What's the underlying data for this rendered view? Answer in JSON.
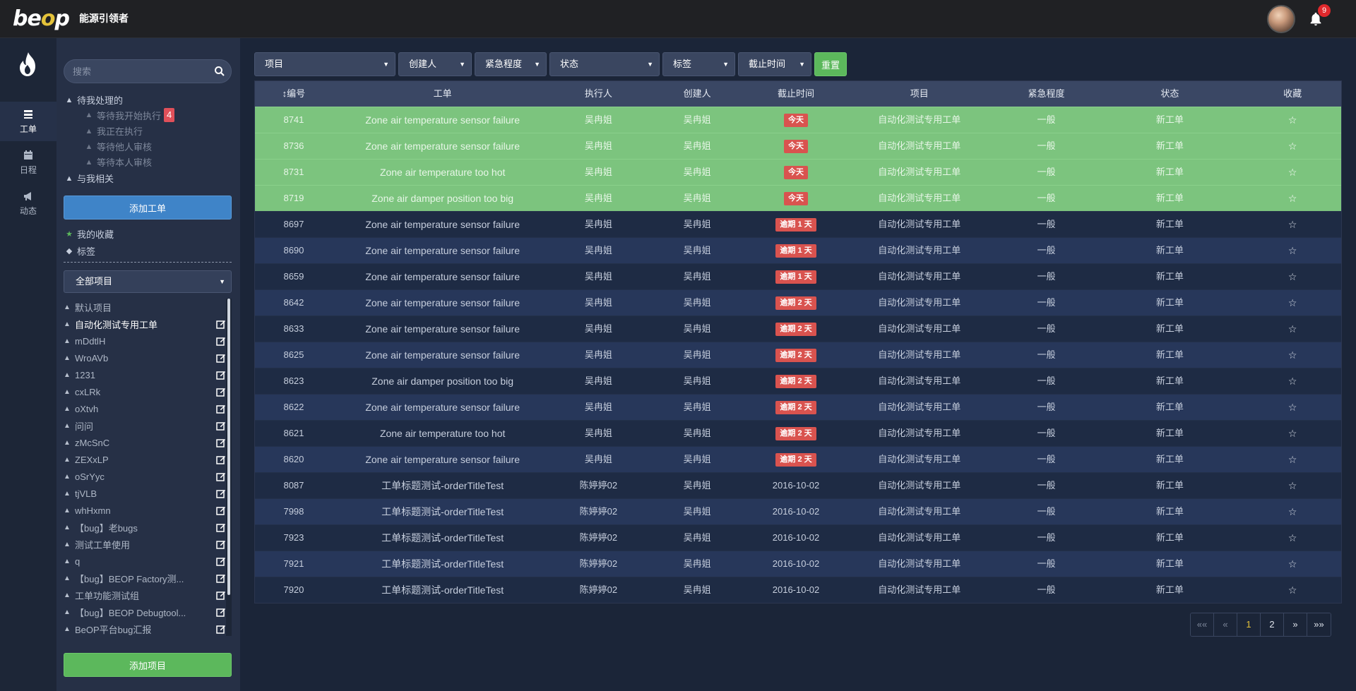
{
  "header": {
    "logo_text": "beop",
    "brand_subtitle": "能源引领者",
    "notification_count": "9",
    "accent": "#e4c23a"
  },
  "iconrail": {
    "items": [
      {
        "label": "工单",
        "icon": "list-icon",
        "active": true
      },
      {
        "label": "日程",
        "icon": "calendar-icon",
        "active": false
      },
      {
        "label": "动态",
        "icon": "megaphone-icon",
        "active": false
      }
    ]
  },
  "sidebar": {
    "search_placeholder": "搜索",
    "pending": {
      "label": "待我处理的",
      "children": [
        {
          "label": "等待我开始执行",
          "badge": "4"
        },
        {
          "label": "我正在执行"
        },
        {
          "label": "等待他人审核"
        },
        {
          "label": "等待本人审核"
        }
      ]
    },
    "related_label": "与我相关",
    "add_workorder_label": "添加工单",
    "favorites_label": "我的收藏",
    "tags_label": "标签",
    "project_select": "全部项目",
    "projects": [
      {
        "name": "默认项目",
        "editable": false
      },
      {
        "name": "自动化测试专用工单",
        "editable": true,
        "active": true
      },
      {
        "name": "mDdtlH",
        "editable": true
      },
      {
        "name": "WroAVb",
        "editable": true
      },
      {
        "name": "1231",
        "editable": true
      },
      {
        "name": "cxLRk",
        "editable": true
      },
      {
        "name": "oXtvh",
        "editable": true
      },
      {
        "name": "问问",
        "editable": true
      },
      {
        "name": "zMcSnC",
        "editable": true
      },
      {
        "name": "ZEXxLP",
        "editable": true
      },
      {
        "name": "oSrYyc",
        "editable": true
      },
      {
        "name": "tjVLB",
        "editable": true
      },
      {
        "name": "whHxmn",
        "editable": true
      },
      {
        "name": "【bug】老bugs",
        "editable": true
      },
      {
        "name": "测试工单使用",
        "editable": true
      },
      {
        "name": "q",
        "editable": true
      },
      {
        "name": "【bug】BEOP Factory测...",
        "editable": true
      },
      {
        "name": "工单功能测试组",
        "editable": true
      },
      {
        "name": "【bug】BEOP Debugtool...",
        "editable": true
      },
      {
        "name": "BeOP平台bug汇报",
        "editable": true
      }
    ],
    "add_project_label": "添加项目"
  },
  "filters": [
    {
      "label": "项目"
    },
    {
      "label": "创建人"
    },
    {
      "label": "紧急程度"
    },
    {
      "label": "状态"
    },
    {
      "label": "标签"
    },
    {
      "label": "截止时间"
    }
  ],
  "reset_label": "重置",
  "table": {
    "columns": [
      "编号",
      "工单",
      "执行人",
      "创建人",
      "截止时间",
      "项目",
      "紧急程度",
      "状态",
      "收藏"
    ],
    "rows": [
      {
        "id": "8741",
        "title": "Zone air temperature sensor failure",
        "executor": "吴冉姐",
        "creator": "吴冉姐",
        "deadline": "今天",
        "deadline_tag": true,
        "project": "自动化测试专用工单",
        "urgency": "一般",
        "status": "新工单",
        "hl": true
      },
      {
        "id": "8736",
        "title": "Zone air temperature sensor failure",
        "executor": "吴冉姐",
        "creator": "吴冉姐",
        "deadline": "今天",
        "deadline_tag": true,
        "project": "自动化测试专用工单",
        "urgency": "一般",
        "status": "新工单",
        "hl": true
      },
      {
        "id": "8731",
        "title": "Zone air temperature too hot",
        "executor": "吴冉姐",
        "creator": "吴冉姐",
        "deadline": "今天",
        "deadline_tag": true,
        "project": "自动化测试专用工单",
        "urgency": "一般",
        "status": "新工单",
        "hl": true
      },
      {
        "id": "8719",
        "title": "Zone air damper position too big",
        "executor": "吴冉姐",
        "creator": "吴冉姐",
        "deadline": "今天",
        "deadline_tag": true,
        "project": "自动化测试专用工单",
        "urgency": "一般",
        "status": "新工单",
        "hl": true
      },
      {
        "id": "8697",
        "title": "Zone air temperature sensor failure",
        "executor": "吴冉姐",
        "creator": "吴冉姐",
        "deadline": "逾期 1 天",
        "deadline_tag": true,
        "project": "自动化测试专用工单",
        "urgency": "一般",
        "status": "新工单"
      },
      {
        "id": "8690",
        "title": "Zone air temperature sensor failure",
        "executor": "吴冉姐",
        "creator": "吴冉姐",
        "deadline": "逾期 1 天",
        "deadline_tag": true,
        "project": "自动化测试专用工单",
        "urgency": "一般",
        "status": "新工单"
      },
      {
        "id": "8659",
        "title": "Zone air temperature sensor failure",
        "executor": "吴冉姐",
        "creator": "吴冉姐",
        "deadline": "逾期 1 天",
        "deadline_tag": true,
        "project": "自动化测试专用工单",
        "urgency": "一般",
        "status": "新工单"
      },
      {
        "id": "8642",
        "title": "Zone air temperature sensor failure",
        "executor": "吴冉姐",
        "creator": "吴冉姐",
        "deadline": "逾期 2 天",
        "deadline_tag": true,
        "project": "自动化测试专用工单",
        "urgency": "一般",
        "status": "新工单"
      },
      {
        "id": "8633",
        "title": "Zone air temperature sensor failure",
        "executor": "吴冉姐",
        "creator": "吴冉姐",
        "deadline": "逾期 2 天",
        "deadline_tag": true,
        "project": "自动化测试专用工单",
        "urgency": "一般",
        "status": "新工单"
      },
      {
        "id": "8625",
        "title": "Zone air temperature sensor failure",
        "executor": "吴冉姐",
        "creator": "吴冉姐",
        "deadline": "逾期 2 天",
        "deadline_tag": true,
        "project": "自动化测试专用工单",
        "urgency": "一般",
        "status": "新工单"
      },
      {
        "id": "8623",
        "title": "Zone air damper position too big",
        "executor": "吴冉姐",
        "creator": "吴冉姐",
        "deadline": "逾期 2 天",
        "deadline_tag": true,
        "project": "自动化测试专用工单",
        "urgency": "一般",
        "status": "新工单"
      },
      {
        "id": "8622",
        "title": "Zone air temperature sensor failure",
        "executor": "吴冉姐",
        "creator": "吴冉姐",
        "deadline": "逾期 2 天",
        "deadline_tag": true,
        "project": "自动化测试专用工单",
        "urgency": "一般",
        "status": "新工单"
      },
      {
        "id": "8621",
        "title": "Zone air temperature too hot",
        "executor": "吴冉姐",
        "creator": "吴冉姐",
        "deadline": "逾期 2 天",
        "deadline_tag": true,
        "project": "自动化测试专用工单",
        "urgency": "一般",
        "status": "新工单"
      },
      {
        "id": "8620",
        "title": "Zone air temperature sensor failure",
        "executor": "吴冉姐",
        "creator": "吴冉姐",
        "deadline": "逾期 2 天",
        "deadline_tag": true,
        "project": "自动化测试专用工单",
        "urgency": "一般",
        "status": "新工单"
      },
      {
        "id": "8087",
        "title": "工单标题测试-orderTitleTest",
        "executor": "陈婷婷02",
        "creator": "吴冉姐",
        "deadline": "2016-10-02",
        "deadline_tag": false,
        "project": "自动化测试专用工单",
        "urgency": "一般",
        "status": "新工单"
      },
      {
        "id": "7998",
        "title": "工单标题测试-orderTitleTest",
        "executor": "陈婷婷02",
        "creator": "吴冉姐",
        "deadline": "2016-10-02",
        "deadline_tag": false,
        "project": "自动化测试专用工单",
        "urgency": "一般",
        "status": "新工单"
      },
      {
        "id": "7923",
        "title": "工单标题测试-orderTitleTest",
        "executor": "陈婷婷02",
        "creator": "吴冉姐",
        "deadline": "2016-10-02",
        "deadline_tag": false,
        "project": "自动化测试专用工单",
        "urgency": "一般",
        "status": "新工单"
      },
      {
        "id": "7921",
        "title": "工单标题测试-orderTitleTest",
        "executor": "陈婷婷02",
        "creator": "吴冉姐",
        "deadline": "2016-10-02",
        "deadline_tag": false,
        "project": "自动化测试专用工单",
        "urgency": "一般",
        "status": "新工单"
      },
      {
        "id": "7920",
        "title": "工单标题测试-orderTitleTest",
        "executor": "陈婷婷02",
        "creator": "吴冉姐",
        "deadline": "2016-10-02",
        "deadline_tag": false,
        "project": "自动化测试专用工单",
        "urgency": "一般",
        "status": "新工单"
      }
    ]
  },
  "pagination": {
    "first": "««",
    "prev": "«",
    "pages": [
      "1",
      "2"
    ],
    "current": "1",
    "next": "»",
    "last": "»»"
  }
}
